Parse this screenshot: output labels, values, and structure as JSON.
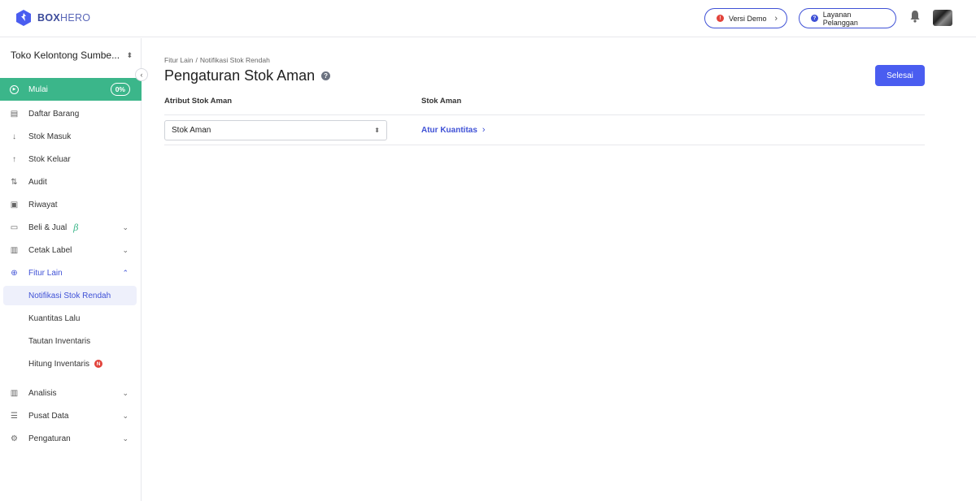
{
  "header": {
    "logo_box": "BOX",
    "logo_hero": "HERO",
    "demo_label": "Versi Demo",
    "support_label": "Layanan Pelanggan"
  },
  "sidebar": {
    "store_name": "Toko Kelontong Sumbe...",
    "start": {
      "label": "Mulai",
      "progress": "0%"
    },
    "items": [
      {
        "label": "Daftar Barang",
        "icon": "list-icon"
      },
      {
        "label": "Stok Masuk",
        "icon": "arrow-down-icon"
      },
      {
        "label": "Stok Keluar",
        "icon": "arrow-up-icon"
      },
      {
        "label": "Audit",
        "icon": "swap-icon"
      },
      {
        "label": "Riwayat",
        "icon": "history-icon"
      },
      {
        "label": "Beli & Jual",
        "icon": "document-icon",
        "badge": "β"
      },
      {
        "label": "Cetak Label",
        "icon": "label-icon"
      },
      {
        "label": "Fitur Lain",
        "icon": "plus-circle-icon"
      }
    ],
    "sub_items": [
      {
        "label": "Notifikasi Stok Rendah",
        "selected": true
      },
      {
        "label": "Kuantitas Lalu"
      },
      {
        "label": "Tautan Inventaris"
      },
      {
        "label": "Hitung Inventaris",
        "badge": "N"
      }
    ],
    "bottom_items": [
      {
        "label": "Analisis",
        "icon": "chart-icon"
      },
      {
        "label": "Pusat Data",
        "icon": "database-icon"
      },
      {
        "label": "Pengaturan",
        "icon": "gear-icon"
      }
    ]
  },
  "main": {
    "breadcrumb": [
      "Fitur Lain",
      "Notifikasi Stok Rendah"
    ],
    "breadcrumb_sep": "/",
    "title": "Pengaturan Stok Aman",
    "done_label": "Selesai",
    "columns": [
      "Atribut Stok Aman",
      "Stok Aman"
    ],
    "select_value": "Stok Aman",
    "link_label": "Atur Kuantitas"
  },
  "colors": {
    "accent": "#4a5df0",
    "start_green": "#3bb68a",
    "alert_red": "#e2433b"
  }
}
